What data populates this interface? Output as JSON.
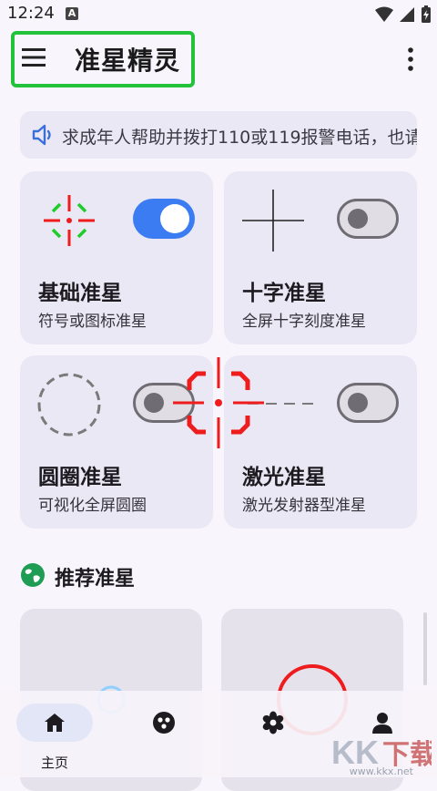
{
  "status": {
    "time": "12:24",
    "badge": "A"
  },
  "appbar": {
    "title": "准星精灵"
  },
  "notice": {
    "text": "求成年人帮助并拨打110或119报警电话，也请"
  },
  "cards": [
    {
      "title": "基础准星",
      "subtitle": "符号或图标准星",
      "enabled": true
    },
    {
      "title": "十字准星",
      "subtitle": "全屏十字刻度准星",
      "enabled": false
    },
    {
      "title": "圆圈准星",
      "subtitle": "可视化全屏圆圈",
      "enabled": false
    },
    {
      "title": "激光准星",
      "subtitle": "激光发射器型准星",
      "enabled": false
    }
  ],
  "recommend": {
    "title": "推荐准星"
  },
  "nav": [
    {
      "label": "主页",
      "icon": "home-icon",
      "selected": true
    },
    {
      "label": "",
      "icon": "palette-icon",
      "selected": false
    },
    {
      "label": "",
      "icon": "flower-icon",
      "selected": false
    },
    {
      "label": "",
      "icon": "person-icon",
      "selected": false
    }
  ],
  "watermark": {
    "text": "KK下载",
    "url": "www.kkx.net"
  },
  "colors": {
    "accent": "#3b7cf2",
    "highlight": "#22c23a",
    "red": "#ee1c1c",
    "green": "#1fcc2a"
  }
}
